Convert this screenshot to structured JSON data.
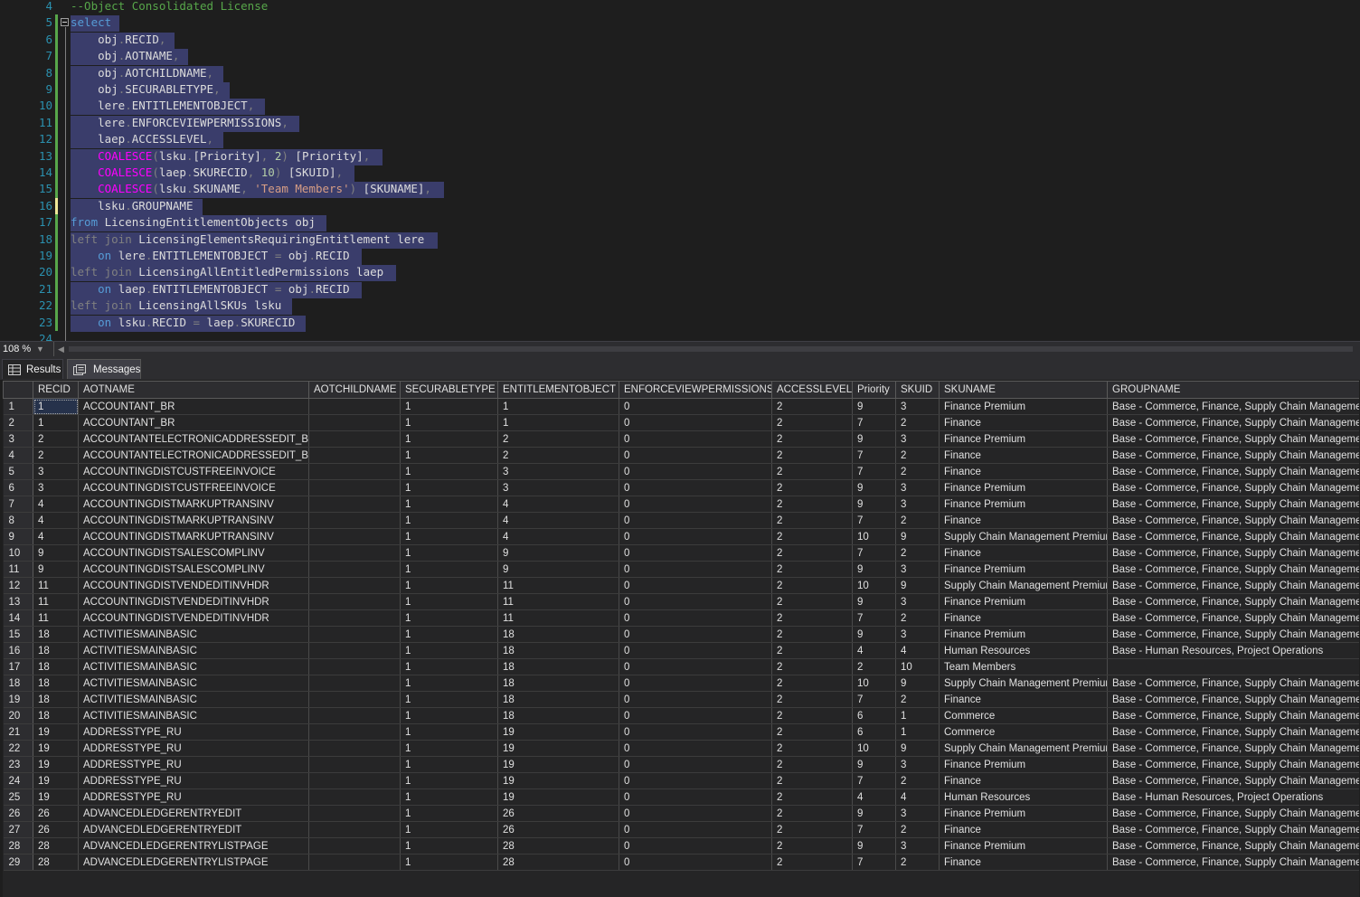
{
  "editor": {
    "zoom": "108 %",
    "line_numbers": [
      "4",
      "5",
      "6",
      "7",
      "8",
      "9",
      "10",
      "11",
      "12",
      "13",
      "14",
      "15",
      "16",
      "17",
      "18",
      "19",
      "20",
      "21",
      "22",
      "23",
      "24"
    ],
    "lines": [
      [
        [
          "cm",
          "--Object Consolidated License"
        ]
      ],
      [
        [
          "kw",
          "select"
        ]
      ],
      [
        [
          "",
          "    obj"
        ],
        [
          "gy",
          "."
        ],
        [
          "",
          "RECID"
        ],
        [
          "gy",
          ","
        ]
      ],
      [
        [
          "",
          "    obj"
        ],
        [
          "gy",
          "."
        ],
        [
          "",
          "AOTNAME"
        ],
        [
          "gy",
          ","
        ]
      ],
      [
        [
          "",
          "    obj"
        ],
        [
          "gy",
          "."
        ],
        [
          "",
          "AOTCHILDNAME"
        ],
        [
          "gy",
          ","
        ]
      ],
      [
        [
          "",
          "    obj"
        ],
        [
          "gy",
          "."
        ],
        [
          "",
          "SECURABLETYPE"
        ],
        [
          "gy",
          ","
        ]
      ],
      [
        [
          "",
          "    lere"
        ],
        [
          "gy",
          "."
        ],
        [
          "",
          "ENTITLEMENTOBJECT"
        ],
        [
          "gy",
          ","
        ]
      ],
      [
        [
          "",
          "    lere"
        ],
        [
          "gy",
          "."
        ],
        [
          "",
          "ENFORCEVIEWPERMISSIONS"
        ],
        [
          "gy",
          ","
        ]
      ],
      [
        [
          "",
          "    laep"
        ],
        [
          "gy",
          "."
        ],
        [
          "",
          "ACCESSLEVEL"
        ],
        [
          "gy",
          ","
        ]
      ],
      [
        [
          "",
          "    "
        ],
        [
          "fn",
          "COALESCE"
        ],
        [
          "gy",
          "("
        ],
        [
          "",
          "lsku"
        ],
        [
          "gy",
          "."
        ],
        [
          "",
          "[Priority]"
        ],
        [
          "gy",
          ", "
        ],
        [
          "nm",
          "2"
        ],
        [
          "gy",
          ")"
        ],
        [
          "",
          " [Priority]"
        ],
        [
          "gy",
          ","
        ]
      ],
      [
        [
          "",
          "    "
        ],
        [
          "fn",
          "COALESCE"
        ],
        [
          "gy",
          "("
        ],
        [
          "",
          "laep"
        ],
        [
          "gy",
          "."
        ],
        [
          "",
          "SKURECID"
        ],
        [
          "gy",
          ", "
        ],
        [
          "nm",
          "10"
        ],
        [
          "gy",
          ")"
        ],
        [
          "",
          " [SKUID]"
        ],
        [
          "gy",
          ","
        ]
      ],
      [
        [
          "",
          "    "
        ],
        [
          "fn",
          "COALESCE"
        ],
        [
          "gy",
          "("
        ],
        [
          "",
          "lsku"
        ],
        [
          "gy",
          "."
        ],
        [
          "",
          "SKUNAME"
        ],
        [
          "gy",
          ", "
        ],
        [
          "st",
          "'Team Members'"
        ],
        [
          "gy",
          ")"
        ],
        [
          "",
          " [SKUNAME]"
        ],
        [
          "gy",
          ","
        ]
      ],
      [
        [
          "",
          "    lsku"
        ],
        [
          "gy",
          "."
        ],
        [
          "",
          "GROUPNAME"
        ]
      ],
      [
        [
          "kw",
          "from"
        ],
        [
          "",
          " LicensingEntitlementObjects obj"
        ]
      ],
      [
        [
          "gy",
          "left join"
        ],
        [
          "",
          " LicensingElementsRequiringEntitlement lere"
        ]
      ],
      [
        [
          "",
          "    "
        ],
        [
          "kw",
          "on"
        ],
        [
          "",
          " lere"
        ],
        [
          "gy",
          "."
        ],
        [
          "",
          "ENTITLEMENTOBJECT "
        ],
        [
          "gy",
          "="
        ],
        [
          "",
          " obj"
        ],
        [
          "gy",
          "."
        ],
        [
          "",
          "RECID"
        ]
      ],
      [
        [
          "gy",
          "left join"
        ],
        [
          "",
          " LicensingAllEntitledPermissions laep"
        ]
      ],
      [
        [
          "",
          "    "
        ],
        [
          "kw",
          "on"
        ],
        [
          "",
          " laep"
        ],
        [
          "gy",
          "."
        ],
        [
          "",
          "ENTITLEMENTOBJECT "
        ],
        [
          "gy",
          "="
        ],
        [
          "",
          " obj"
        ],
        [
          "gy",
          "."
        ],
        [
          "",
          "RECID"
        ]
      ],
      [
        [
          "gy",
          "left join"
        ],
        [
          "",
          " LicensingAllSKUs lsku"
        ]
      ],
      [
        [
          "",
          "    "
        ],
        [
          "kw",
          "on"
        ],
        [
          "",
          " lsku"
        ],
        [
          "gy",
          "."
        ],
        [
          "",
          "RECID "
        ],
        [
          "gy",
          "="
        ],
        [
          "",
          " laep"
        ],
        [
          "gy",
          "."
        ],
        [
          "",
          "SKURECID"
        ]
      ],
      []
    ]
  },
  "tabs": {
    "results": "Results",
    "messages": "Messages"
  },
  "grid": {
    "columns": [
      "",
      "RECID",
      "AOTNAME",
      "AOTCHILDNAME",
      "SECURABLETYPE",
      "ENTITLEMENTOBJECT",
      "ENFORCEVIEWPERMISSIONS",
      "ACCESSLEVEL",
      "Priority",
      "SKUID",
      "SKUNAME",
      "GROUPNAME"
    ],
    "rows": [
      [
        "1",
        "1",
        "ACCOUNTANT_BR",
        "",
        "1",
        "1",
        "0",
        "2",
        "9",
        "3",
        "Finance Premium",
        "Base - Commerce, Finance, Supply Chain Management"
      ],
      [
        "2",
        "1",
        "ACCOUNTANT_BR",
        "",
        "1",
        "1",
        "0",
        "2",
        "7",
        "2",
        "Finance",
        "Base - Commerce, Finance, Supply Chain Management"
      ],
      [
        "3",
        "2",
        "ACCOUNTANTELECTRONICADDRESSEDIT_BR",
        "",
        "1",
        "2",
        "0",
        "2",
        "9",
        "3",
        "Finance Premium",
        "Base - Commerce, Finance, Supply Chain Management"
      ],
      [
        "4",
        "2",
        "ACCOUNTANTELECTRONICADDRESSEDIT_BR",
        "",
        "1",
        "2",
        "0",
        "2",
        "7",
        "2",
        "Finance",
        "Base - Commerce, Finance, Supply Chain Management"
      ],
      [
        "5",
        "3",
        "ACCOUNTINGDISTCUSTFREEINVOICE",
        "",
        "1",
        "3",
        "0",
        "2",
        "7",
        "2",
        "Finance",
        "Base - Commerce, Finance, Supply Chain Management"
      ],
      [
        "6",
        "3",
        "ACCOUNTINGDISTCUSTFREEINVOICE",
        "",
        "1",
        "3",
        "0",
        "2",
        "9",
        "3",
        "Finance Premium",
        "Base - Commerce, Finance, Supply Chain Management"
      ],
      [
        "7",
        "4",
        "ACCOUNTINGDISTMARKUPTRANSINV",
        "",
        "1",
        "4",
        "0",
        "2",
        "9",
        "3",
        "Finance Premium",
        "Base - Commerce, Finance, Supply Chain Management"
      ],
      [
        "8",
        "4",
        "ACCOUNTINGDISTMARKUPTRANSINV",
        "",
        "1",
        "4",
        "0",
        "2",
        "7",
        "2",
        "Finance",
        "Base - Commerce, Finance, Supply Chain Management"
      ],
      [
        "9",
        "4",
        "ACCOUNTINGDISTMARKUPTRANSINV",
        "",
        "1",
        "4",
        "0",
        "2",
        "10",
        "9",
        "Supply Chain Management Premium",
        "Base - Commerce, Finance, Supply Chain Management"
      ],
      [
        "10",
        "9",
        "ACCOUNTINGDISTSALESCOMPLINV",
        "",
        "1",
        "9",
        "0",
        "2",
        "7",
        "2",
        "Finance",
        "Base - Commerce, Finance, Supply Chain Management"
      ],
      [
        "11",
        "9",
        "ACCOUNTINGDISTSALESCOMPLINV",
        "",
        "1",
        "9",
        "0",
        "2",
        "9",
        "3",
        "Finance Premium",
        "Base - Commerce, Finance, Supply Chain Management"
      ],
      [
        "12",
        "11",
        "ACCOUNTINGDISTVENDEDITINVHDR",
        "",
        "1",
        "11",
        "0",
        "2",
        "10",
        "9",
        "Supply Chain Management Premium",
        "Base - Commerce, Finance, Supply Chain Management"
      ],
      [
        "13",
        "11",
        "ACCOUNTINGDISTVENDEDITINVHDR",
        "",
        "1",
        "11",
        "0",
        "2",
        "9",
        "3",
        "Finance Premium",
        "Base - Commerce, Finance, Supply Chain Management"
      ],
      [
        "14",
        "11",
        "ACCOUNTINGDISTVENDEDITINVHDR",
        "",
        "1",
        "11",
        "0",
        "2",
        "7",
        "2",
        "Finance",
        "Base - Commerce, Finance, Supply Chain Management"
      ],
      [
        "15",
        "18",
        "ACTIVITIESMAINBASIC",
        "",
        "1",
        "18",
        "0",
        "2",
        "9",
        "3",
        "Finance Premium",
        "Base - Commerce, Finance, Supply Chain Management"
      ],
      [
        "16",
        "18",
        "ACTIVITIESMAINBASIC",
        "",
        "1",
        "18",
        "0",
        "2",
        "4",
        "4",
        "Human Resources",
        "Base - Human Resources, Project Operations"
      ],
      [
        "17",
        "18",
        "ACTIVITIESMAINBASIC",
        "",
        "1",
        "18",
        "0",
        "2",
        "2",
        "10",
        "Team Members",
        ""
      ],
      [
        "18",
        "18",
        "ACTIVITIESMAINBASIC",
        "",
        "1",
        "18",
        "0",
        "2",
        "10",
        "9",
        "Supply Chain Management Premium",
        "Base - Commerce, Finance, Supply Chain Management"
      ],
      [
        "19",
        "18",
        "ACTIVITIESMAINBASIC",
        "",
        "1",
        "18",
        "0",
        "2",
        "7",
        "2",
        "Finance",
        "Base - Commerce, Finance, Supply Chain Management"
      ],
      [
        "20",
        "18",
        "ACTIVITIESMAINBASIC",
        "",
        "1",
        "18",
        "0",
        "2",
        "6",
        "1",
        "Commerce",
        "Base - Commerce, Finance, Supply Chain Management"
      ],
      [
        "21",
        "19",
        "ADDRESSTYPE_RU",
        "",
        "1",
        "19",
        "0",
        "2",
        "6",
        "1",
        "Commerce",
        "Base - Commerce, Finance, Supply Chain Management"
      ],
      [
        "22",
        "19",
        "ADDRESSTYPE_RU",
        "",
        "1",
        "19",
        "0",
        "2",
        "10",
        "9",
        "Supply Chain Management Premium",
        "Base - Commerce, Finance, Supply Chain Management"
      ],
      [
        "23",
        "19",
        "ADDRESSTYPE_RU",
        "",
        "1",
        "19",
        "0",
        "2",
        "9",
        "3",
        "Finance Premium",
        "Base - Commerce, Finance, Supply Chain Management"
      ],
      [
        "24",
        "19",
        "ADDRESSTYPE_RU",
        "",
        "1",
        "19",
        "0",
        "2",
        "7",
        "2",
        "Finance",
        "Base - Commerce, Finance, Supply Chain Management"
      ],
      [
        "25",
        "19",
        "ADDRESSTYPE_RU",
        "",
        "1",
        "19",
        "0",
        "2",
        "4",
        "4",
        "Human Resources",
        "Base - Human Resources, Project Operations"
      ],
      [
        "26",
        "26",
        "ADVANCEDLEDGERENTRYEDIT",
        "",
        "1",
        "26",
        "0",
        "2",
        "9",
        "3",
        "Finance Premium",
        "Base - Commerce, Finance, Supply Chain Management"
      ],
      [
        "27",
        "26",
        "ADVANCEDLEDGERENTRYEDIT",
        "",
        "1",
        "26",
        "0",
        "2",
        "7",
        "2",
        "Finance",
        "Base - Commerce, Finance, Supply Chain Management"
      ],
      [
        "28",
        "28",
        "ADVANCEDLEDGERENTRYLISTPAGE",
        "",
        "1",
        "28",
        "0",
        "2",
        "9",
        "3",
        "Finance Premium",
        "Base - Commerce, Finance, Supply Chain Management"
      ],
      [
        "29",
        "28",
        "ADVANCEDLEDGERENTRYLISTPAGE",
        "",
        "1",
        "28",
        "0",
        "2",
        "7",
        "2",
        "Finance",
        "Base - Commerce, Finance, Supply Chain Management"
      ]
    ]
  },
  "colors": {
    "selection": "#3a3d6b",
    "keyword": "#569cd6",
    "function": "#ff00ff",
    "comment": "#57a64a",
    "string": "#d69d85",
    "line_number": "#2b91af"
  }
}
